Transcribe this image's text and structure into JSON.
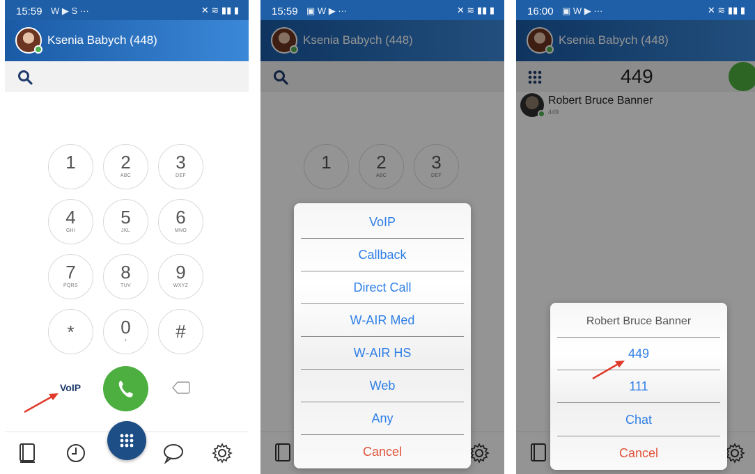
{
  "panel1": {
    "status_time": "15:59",
    "status_icons": "W ▶ S ···",
    "title": "Ksenia Babych (448)",
    "keys": [
      {
        "digit": "1",
        "sub": ""
      },
      {
        "digit": "2",
        "sub": "ABC"
      },
      {
        "digit": "3",
        "sub": "DEF"
      },
      {
        "digit": "4",
        "sub": "GHI"
      },
      {
        "digit": "5",
        "sub": "JKL"
      },
      {
        "digit": "6",
        "sub": "MNO"
      },
      {
        "digit": "7",
        "sub": "PQRS"
      },
      {
        "digit": "8",
        "sub": "TUV"
      },
      {
        "digit": "9",
        "sub": "WXYZ"
      },
      {
        "digit": "*",
        "sub": ""
      },
      {
        "digit": "0",
        "sub": "+"
      },
      {
        "digit": "#",
        "sub": ""
      }
    ],
    "call_mode": "VoIP"
  },
  "panel2": {
    "status_time": "15:59",
    "status_icons": "▣ W ▶ ···",
    "title": "Ksenia Babych (448)",
    "options": [
      "VoIP",
      "Callback",
      "Direct  Call",
      "W-AIR Med",
      "W-AIR HS",
      "Web",
      "Any"
    ],
    "cancel": "Cancel"
  },
  "panel3": {
    "status_time": "16:00",
    "status_icons": "▣ W ▶ ···",
    "title": "Ksenia Babych (448)",
    "dialed": "449",
    "contact_name": "Robert Bruce Banner",
    "contact_ext": "449",
    "sheet_header": "Robert Bruce Banner",
    "options": [
      "449",
      "111",
      "Chat"
    ],
    "cancel": "Cancel"
  },
  "colors": {
    "header_blue": "#1f5fa8",
    "call_green": "#4caf3f",
    "option_blue": "#2f7fe6",
    "cancel_red": "#e0533a",
    "fab_navy": "#1d4e86",
    "arrow_red": "#e03a2a"
  }
}
